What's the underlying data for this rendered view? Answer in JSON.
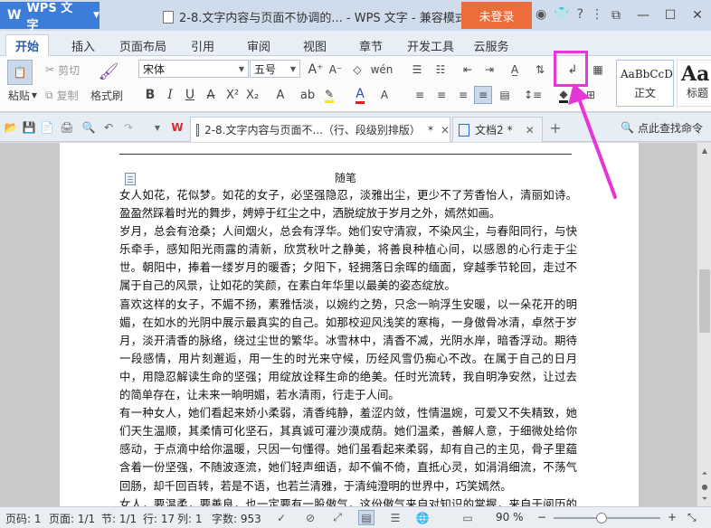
{
  "titlebar": {
    "brand": "WPS 文字",
    "doc_title": "2-8.文字内容与页面不协调的... - WPS 文字 - 兼容模式",
    "login_label": "未登录"
  },
  "menu": {
    "tabs": [
      "开始",
      "插入",
      "页面布局",
      "引用",
      "审阅",
      "视图",
      "章节",
      "开发工具",
      "云服务"
    ],
    "active": "开始"
  },
  "ribbon": {
    "paste_label": "粘贴",
    "cut_label": "剪切",
    "copy_label": "复制",
    "format_painter_label": "格式刷",
    "font_name": "宋体",
    "font_size": "五号",
    "styles": [
      {
        "sample": "AaBbCcD",
        "name": "正文"
      },
      {
        "sample": "Aa",
        "name": "标题"
      }
    ]
  },
  "doctabs": [
    {
      "label": "2-8.文字内容与页面不...（行、段级别排版）",
      "modified": "*",
      "active": true
    },
    {
      "label": "文档2",
      "modified": "*",
      "active": false
    }
  ],
  "search_cmd": "点此查找命令",
  "document": {
    "heading": "随笔",
    "paragraphs": [
      "女人如花，花似梦。如花的女子，必坚强隐忍，淡雅出尘，更少不了芳香怡人，清丽如诗。盈盈然踩着时光的舞步，娉婷于红尘之中，洒脱绽放于岁月之外，嫣然如画。",
      "岁月，总会有沧桑；人间烟火，总会有浮华。她们安守清寂，不染风尘，与春阳同行，与快乐牵手，感知阳光雨露的清新，欣赏秋叶之静美，将善良种植心间，以感恩的心行走于尘世。朝阳中，捧着一缕岁月的暖香；夕阳下，轻拥落日余晖的缅面，穿越季节轮回，走过不属于自己的风景，让如花的笑颜，在素白年华里以最美的姿态绽放。",
      "喜欢这样的女子，不媚不扬，素雅恬淡，以婉约之势，只念一晌浮生安暖，以一朵花开的明媚，在如水的光阴中展示最真实的自己。如那校迎风浅笑的寒梅，一身傲骨冰清，卓然于岁月，淡开清香的脉络，绕过尘世的繁华。冰雪林中，清香不减，光阴水岸，暗香浮动。期待一段感情，用片刻邂逅，用一生的时光来守候，历经风雪仍痴心不改。在属于自己的日月中，用隐忍解读生命的坚强；用绽放诠释生命的绝美。任时光流转，我自明净安然，让过去的简单存在，让未来一晌明媚，若水清雨，行走于人间。",
      "有一种女人，她们看起来娇小柔弱，清香纯静，羞涩内敛，性情温婉，可爱又不失精致，她们天生温顺，其柔情可化坚石，其真诚可灌沙漠成荫。她们温柔，善解人意，于细微处给你感动，于点滴中给你温暖，只因一句懂得。她们虽看起来柔弱，却有自己的主见，骨子里蕴含着一份坚强，不随波逐流，她们轻声细语，却不偏不倚，直抵心灵，如涓涓细流，不荡气回肠，却千回百转，若是不语，也若兰清雅，于清纯澄明的世界中，巧笑嫣然。",
      "女人，要温柔，要善良，也一定要有一股傲气，这份傲气来自对知识的掌握，来自于阅历的提升，来自日积月累的沉淀，是发自心底的自信。女人，无论你是青春的，淡雅的，或是熏"
    ]
  },
  "statusbar": {
    "page_num": "页码: 1",
    "page_of": "页面: 1/1",
    "section": "节: 1/1",
    "row": "行: 17",
    "col": "列: 1",
    "word_count": "字数: 953",
    "zoom": "90 %",
    "zoom_fraction": 0.45
  },
  "colors": {
    "brand_blue": "#3b7dd8",
    "login_orange": "#ee6b3a",
    "annotation_magenta": "#e636d8"
  }
}
